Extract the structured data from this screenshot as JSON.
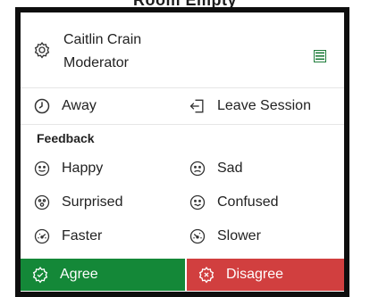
{
  "background": {
    "title": "Room Empty"
  },
  "user": {
    "name": "Caitlin Crain",
    "role": "Moderator",
    "list_icon": "list-icon",
    "gear_icon": "settings-gear-icon",
    "accent": "#1e7c3a"
  },
  "status": {
    "away_label": "Away",
    "leave_label": "Leave Session"
  },
  "feedback": {
    "title": "Feedback",
    "items": [
      {
        "label": "Happy"
      },
      {
        "label": "Sad"
      },
      {
        "label": "Surprised"
      },
      {
        "label": "Confused"
      },
      {
        "label": "Faster"
      },
      {
        "label": "Slower"
      }
    ],
    "agree_label": "Agree",
    "disagree_label": "Disagree",
    "agree_color": "#148838",
    "disagree_color": "#d13f3f"
  }
}
